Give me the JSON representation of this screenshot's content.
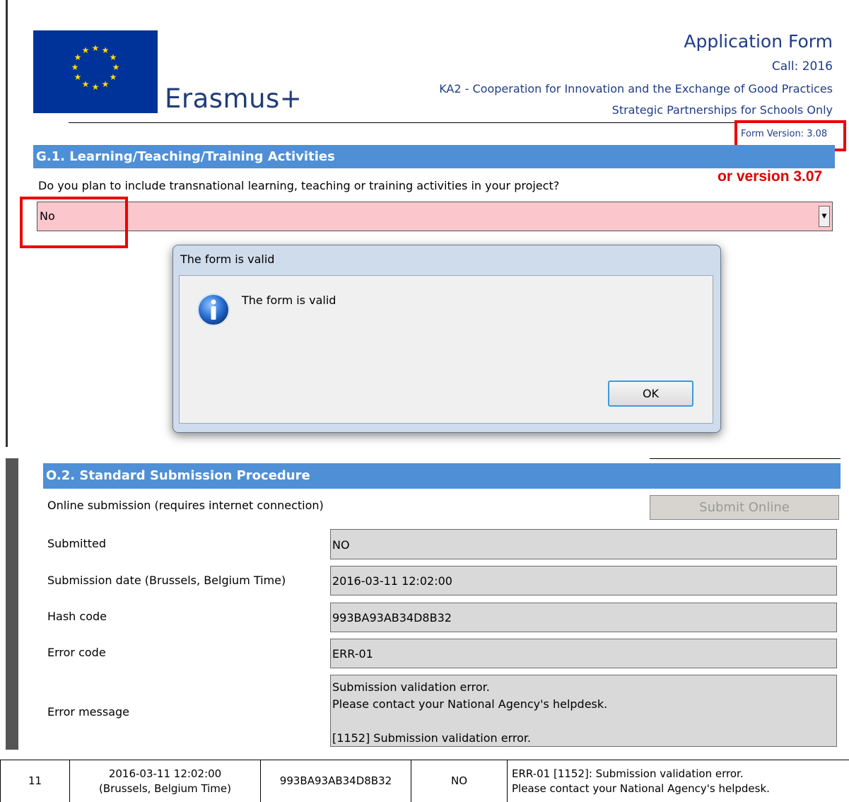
{
  "header": {
    "brand": "Erasmus+",
    "title": "Application Form",
    "call": "Call: 2016",
    "action": "KA2 - Cooperation for Innovation and the Exchange of Good Practices",
    "subtitle": "Strategic Partnerships for Schools Only",
    "form_version": "Form Version: 3.08",
    "alt_version_note": "or version 3.07"
  },
  "section_g1": {
    "title": "G.1. Learning/Teaching/Training Activities",
    "question": "Do you plan to include transnational learning, teaching or training activities in your project?",
    "answer": "No"
  },
  "dialog": {
    "title": "The form is valid",
    "message": "The form is valid",
    "ok_label": "OK"
  },
  "section_o2": {
    "title": "O.2. Standard Submission Procedure",
    "online_label": "Online submission (requires internet connection)",
    "submit_label": "Submit Online",
    "fields": [
      {
        "label": "Submitted",
        "value": "NO"
      },
      {
        "label": "Submission date (Brussels, Belgium Time)",
        "value": "2016-03-11 12:02:00"
      },
      {
        "label": "Hash code",
        "value": "993BA93AB34D8B32"
      },
      {
        "label": "Error code",
        "value": "ERR-01"
      }
    ],
    "error_message_label": "Error message",
    "error_message_lines": [
      "Submission validation error.",
      "Please contact your National Agency's helpdesk.",
      "",
      "[1152] Submission validation error."
    ]
  },
  "history_row": {
    "number": "11",
    "date_line1": "2016-03-11 12:02:00",
    "date_line2": "(Brussels, Belgium Time)",
    "hash": "993BA93AB34D8B32",
    "submitted": "NO",
    "error_line1": "ERR-01 [1152]: Submission validation error.",
    "error_line2": "Please contact your National Agency's helpdesk."
  },
  "colors": {
    "section_blue": "#4f8fd6",
    "eu_blue": "#003399",
    "eu_star": "#ffdd00",
    "highlight_red": "#ee0000",
    "select_pink": "#fbc6cc",
    "field_grey": "#d9d9d9"
  },
  "icons": [
    "eu-flag-icon",
    "info-icon",
    "dropdown-arrow-icon"
  ]
}
